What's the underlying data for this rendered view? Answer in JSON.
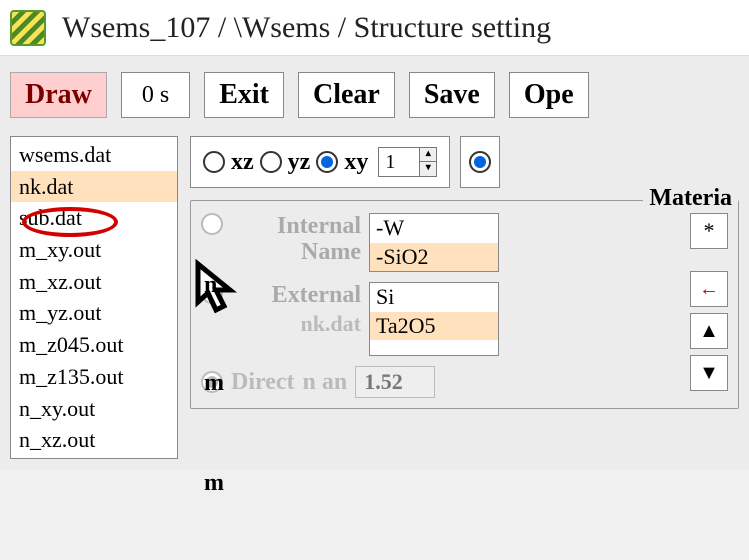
{
  "title": "Wsems_107 / \\Wsems / Structure setting",
  "toolbar": {
    "draw": "Draw",
    "time": "0 s",
    "exit": "Exit",
    "clear": "Clear",
    "save": "Save",
    "open": "Ope"
  },
  "files": {
    "items": [
      "wsems.dat",
      "nk.dat",
      "sub.dat",
      "m_xy.out",
      "m_xz.out",
      "m_yz.out",
      "m_z045.out",
      "m_z135.out",
      "n_xy.out",
      "n_xz.out"
    ],
    "selected_index": 1
  },
  "plane": {
    "xz": "xz",
    "yz": "yz",
    "xy": "xy",
    "layer_value": "1"
  },
  "sidechars": {
    "n": "n",
    "m": "m",
    "m2": "m"
  },
  "material": {
    "legend": "Materia",
    "internal_label_line1": "Internal",
    "internal_label_line2": "Name",
    "internal_items": [
      "-W",
      "-SiO2"
    ],
    "external_label": "External",
    "nkdat_label": "nk.dat",
    "external_items": [
      "Si",
      "Ta2O5"
    ],
    "direct_label": "Direct",
    "n_label": "n an",
    "n_value": "1.52",
    "star": "*"
  }
}
